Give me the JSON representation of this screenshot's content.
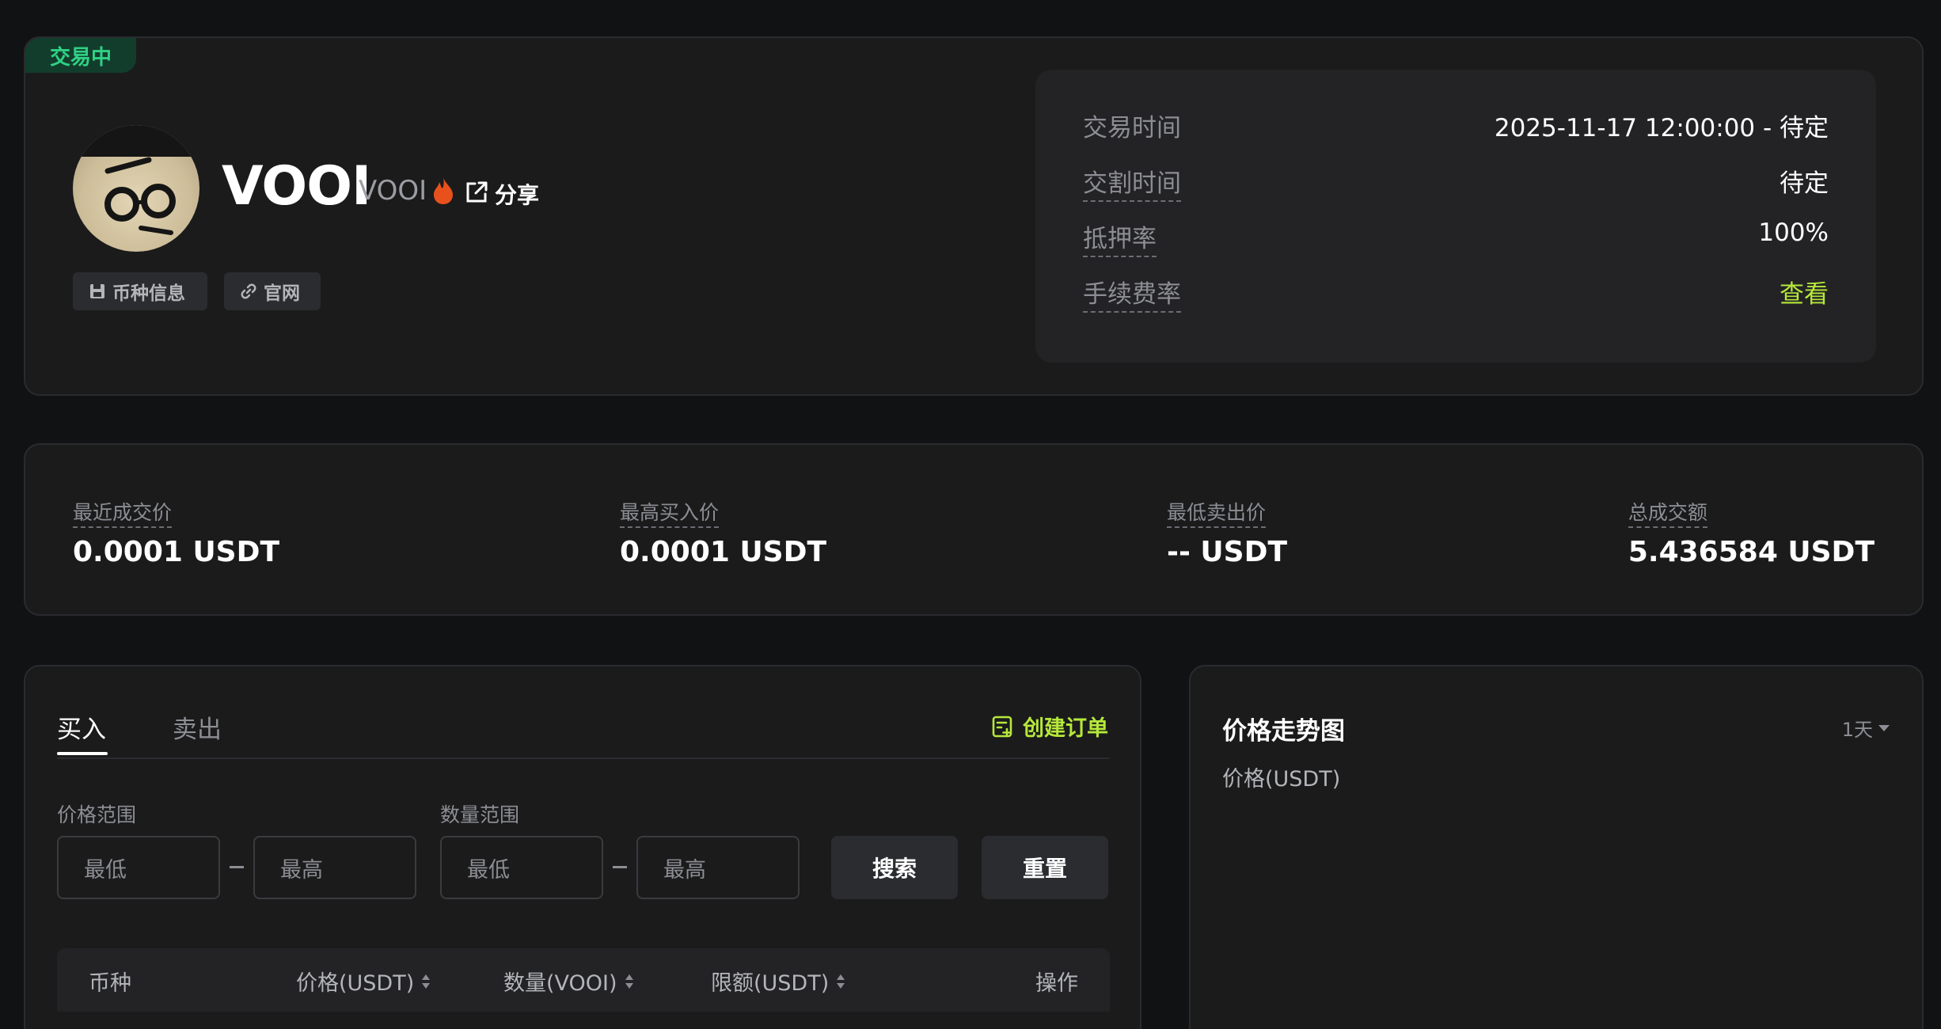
{
  "header": {
    "status": "交易中",
    "token_name": "VOOI",
    "token_symbol": "VOOI",
    "share_label": "分享",
    "pills": {
      "info": "币种信息",
      "website": "官网"
    }
  },
  "info": {
    "rows": [
      {
        "label": "交易时间",
        "value": "2025-11-17 12:00:00 - 待定"
      },
      {
        "label": "交割时间",
        "value": "待定"
      },
      {
        "label": "抵押率",
        "value": "100%"
      },
      {
        "label": "手续费率",
        "value": "查看"
      }
    ]
  },
  "stats": [
    {
      "label": "最近成交价",
      "value": "0.0001 USDT"
    },
    {
      "label": "最高买入价",
      "value": "0.0001 USDT"
    },
    {
      "label": "最低卖出价",
      "value": "-- USDT"
    },
    {
      "label": "总成交额",
      "value": "5.436584 USDT"
    }
  ],
  "orders": {
    "tabs": [
      "买入",
      "卖出"
    ],
    "create_order": "创建订单",
    "price_range_label": "价格范围",
    "amount_range_label": "数量范围",
    "min_placeholder": "最低",
    "max_placeholder": "最高",
    "search_button": "搜索",
    "reset_button": "重置",
    "columns": [
      "币种",
      "价格(USDT)",
      "数量(VOOI)",
      "限额(USDT)",
      "操作"
    ]
  },
  "chart": {
    "title": "价格走势图",
    "period": "1天",
    "unit": "价格(USDT)"
  },
  "colors": {
    "accent": "#b6e83b",
    "status": "#2fd184",
    "fire": "#e8511c"
  }
}
